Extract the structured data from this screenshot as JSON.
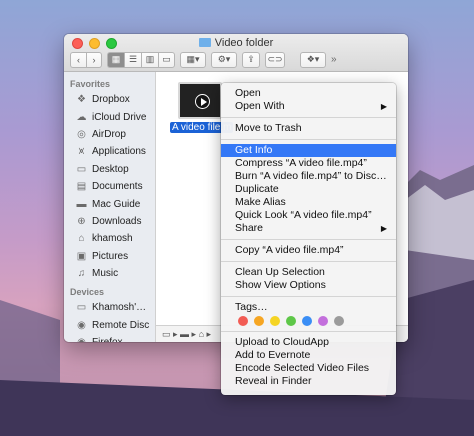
{
  "window": {
    "title": "Video folder"
  },
  "toolbar": {
    "back": "‹",
    "forward": "›",
    "overflow": "»"
  },
  "sidebar": {
    "favorites_header": "Favorites",
    "favorites": [
      {
        "label": "Dropbox",
        "icon": "dropbox-icon"
      },
      {
        "label": "iCloud Drive",
        "icon": "cloud-icon"
      },
      {
        "label": "AirDrop",
        "icon": "airdrop-icon"
      },
      {
        "label": "Applications",
        "icon": "applications-icon"
      },
      {
        "label": "Desktop",
        "icon": "desktop-icon"
      },
      {
        "label": "Documents",
        "icon": "documents-icon"
      },
      {
        "label": "Mac Guide",
        "icon": "folder-icon"
      },
      {
        "label": "Downloads",
        "icon": "downloads-icon"
      },
      {
        "label": "khamosh",
        "icon": "home-icon"
      },
      {
        "label": "Pictures",
        "icon": "pictures-icon"
      },
      {
        "label": "Music",
        "icon": "music-icon"
      }
    ],
    "devices_header": "Devices",
    "devices": [
      {
        "label": "Khamosh'…",
        "icon": "computer-icon"
      },
      {
        "label": "Remote Disc",
        "icon": "disc-icon"
      },
      {
        "label": "Firefox",
        "icon": "disc-icon"
      }
    ]
  },
  "file": {
    "name": "A video file.m"
  },
  "context_menu": {
    "items": [
      {
        "label": "Open"
      },
      {
        "label": "Open With",
        "submenu": true
      },
      {
        "sep": true
      },
      {
        "label": "Move to Trash"
      },
      {
        "sep": true
      },
      {
        "label": "Get Info",
        "highlighted": true
      },
      {
        "label": "Compress “A video file.mp4”"
      },
      {
        "label": "Burn “A video file.mp4” to Disc…"
      },
      {
        "label": "Duplicate"
      },
      {
        "label": "Make Alias"
      },
      {
        "label": "Quick Look “A video file.mp4”"
      },
      {
        "label": "Share",
        "submenu": true
      },
      {
        "sep": true
      },
      {
        "label": "Copy “A video file.mp4”"
      },
      {
        "sep": true
      },
      {
        "label": "Clean Up Selection"
      },
      {
        "label": "Show View Options"
      },
      {
        "sep": true
      },
      {
        "label": "Tags…"
      },
      {
        "tags": true
      },
      {
        "sep": true
      },
      {
        "label": "Upload to CloudApp"
      },
      {
        "label": "Add to Evernote"
      },
      {
        "label": "Encode Selected Video Files"
      },
      {
        "label": "Reveal in Finder"
      }
    ],
    "tag_colors": [
      "#f25c54",
      "#f6a623",
      "#f5d423",
      "#5ec748",
      "#3a8ef5",
      "#c36fdc",
      "#9b9b9b"
    ]
  },
  "colors": {
    "highlight": "#3478f6",
    "selection": "#1b62d6"
  }
}
